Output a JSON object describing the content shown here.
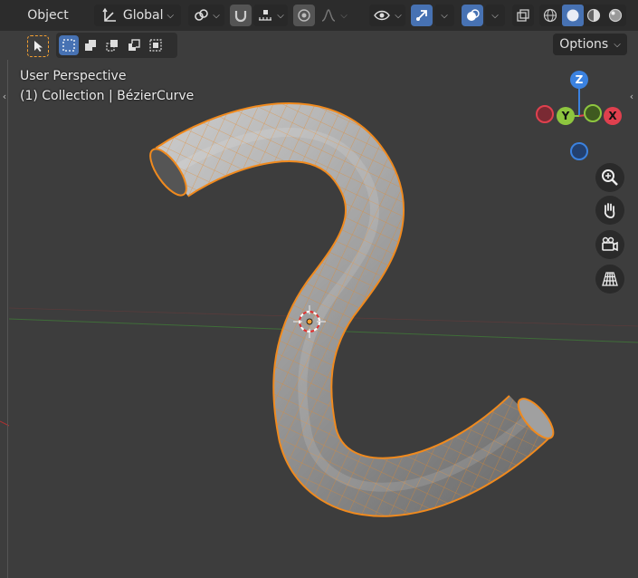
{
  "header": {
    "mode_label": "Object",
    "transform_orientation": "Global",
    "options_label": "Options"
  },
  "viewport": {
    "view_name": "User Perspective",
    "collection_label": "(1) Collection | BézierCurve"
  },
  "gizmo": {
    "z_label": "Z",
    "y_label": "Y",
    "x_label": "X",
    "x_color": "#e0404e",
    "y_color": "#8ec63f",
    "z_color": "#3b82e0"
  },
  "colors": {
    "accent_blue": "#4772b3",
    "selection_orange": "#f5a031",
    "viewport_bg": "#3d3d3d",
    "header_bg": "#2c2c2c"
  },
  "icons": {
    "transform_orientation": "transform-orientation-icon",
    "pivot": "pivot-point-icon",
    "snap": "snap-magnet-icon",
    "snap_increment": "snap-increment-icon",
    "proportional": "proportional-editing-icon",
    "falloff": "falloff-curve-icon",
    "visibility": "eye-icon",
    "gizmo": "gizmo-arrow-icon",
    "overlays": "overlays-icon",
    "xray": "xray-icon",
    "shading_wire": "wireframe-shading-icon",
    "shading_solid": "solid-shading-icon",
    "shading_material": "material-shading-icon",
    "shading_rendered": "rendered-shading-icon",
    "zoom": "zoom-icon",
    "pan": "hand-pan-icon",
    "camera": "camera-view-icon",
    "ortho": "perspective-grid-icon"
  }
}
